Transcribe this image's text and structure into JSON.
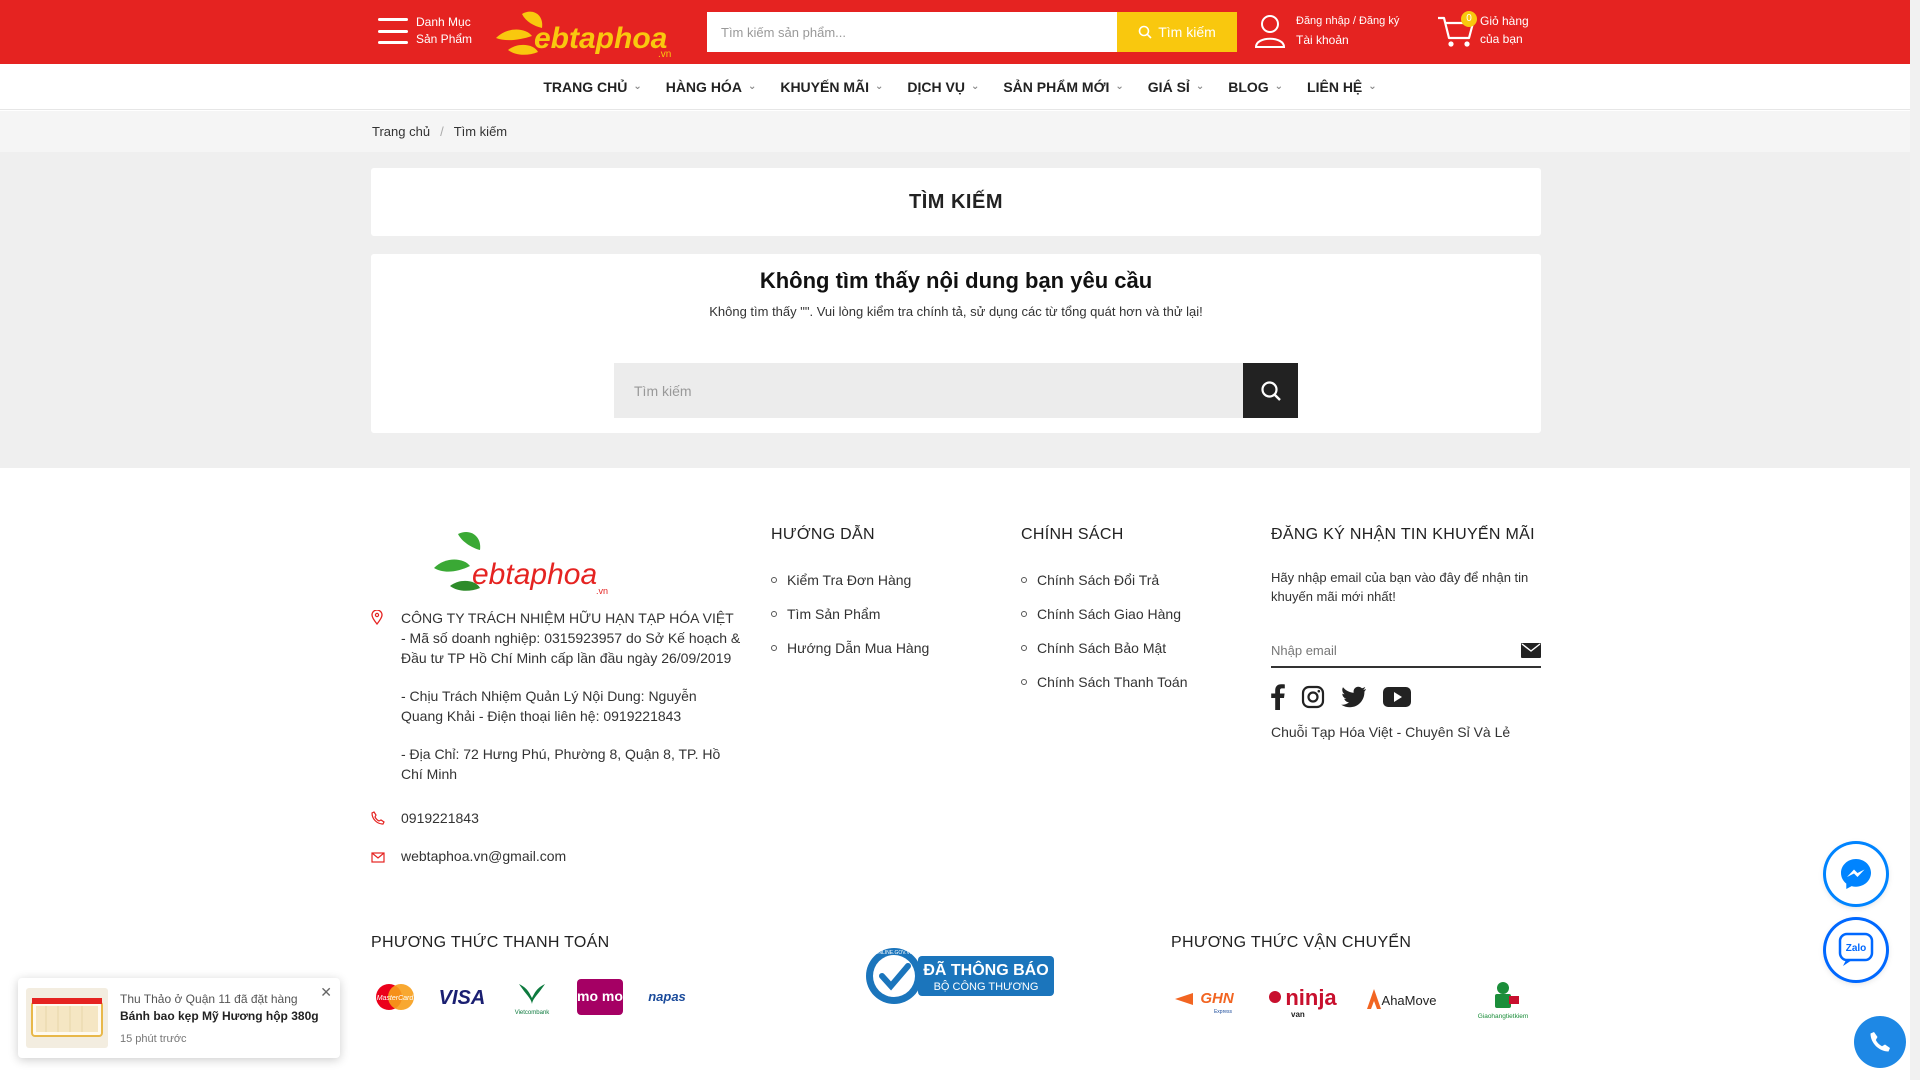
{
  "header": {
    "menu_line1": "Danh Mục",
    "menu_line2": "Sản Phẩm",
    "logo_text": "ebtaphoa",
    "logo_suffix": ".vn",
    "search_placeholder": "Tìm kiếm sản phẩm...",
    "search_button": "Tìm kiếm",
    "account_line1": "Đăng nhập / Đăng ký",
    "account_line2": "Tài khoản",
    "cart_count": "0",
    "cart_line1": "Giỏ hàng",
    "cart_line2": "của bạn"
  },
  "nav": {
    "items": [
      "TRANG CHỦ",
      "HÀNG HÓA",
      "KHUYẾN MÃI",
      "DỊCH VỤ",
      "SẢN PHẨM MỚI",
      "GIÁ SỈ",
      "BLOG",
      "LIÊN HỆ"
    ]
  },
  "breadcrumb": {
    "home": "Trang chủ",
    "separator": "/",
    "current": "Tìm kiếm"
  },
  "main": {
    "page_title": "TÌM KIẾM",
    "not_found_title": "Không tìm thấy nội dung bạn yêu cầu",
    "not_found_desc": "Không tìm thấy \"\". Vui lòng kiểm tra chính tả, sử dụng các từ tổng quát hơn và thử lại!",
    "search_placeholder": "Tìm kiếm"
  },
  "footer": {
    "company": "CÔNG TY TRÁCH NHIỆM HỮU HẠN TẠP HÓA VIỆT - Mã số doanh nghiệp: 0315923957 do Sở Kế hoạch & Đầu tư TP Hồ Chí Minh cấp lần đầu ngày 26/09/2019",
    "manager": "- Chịu Trách Nhiệm Quản Lý Nội Dung: Nguyễn Quang Khải - Điện thoại liên hệ: 0919221843",
    "address": "- Địa Chỉ: 72 Hưng Phú, Phường 8, Quận 8, TP. Hồ Chí Minh",
    "phone": "0919221843",
    "email": "webtaphoa.vn@gmail.com",
    "guide_title": "HƯỚNG DẪN",
    "guide_items": [
      "Kiểm Tra Đơn Hàng",
      "Tìm Sản Phẩm",
      "Hướng Dẫn Mua Hàng"
    ],
    "policy_title": "CHÍNH SÁCH",
    "policy_items": [
      "Chính Sách Đổi Trả",
      "Chính Sách Giao Hàng",
      "Chính Sách Bảo Mật",
      "Chính Sách Thanh Toán"
    ],
    "subscribe_title": "ĐĂNG KÝ NHẬN TIN KHUYẾN MÃI",
    "subscribe_desc": "Hãy nhập email của bạn vào đây để nhận tin khuyến mãi mới nhất!",
    "email_placeholder": "Nhập email",
    "tagline": "Chuỗi Tạp Hóa Việt - Chuyên Sỉ Và Lẻ",
    "payment_title": "PHƯƠNG THỨC THANH TOÁN",
    "payment_logos": [
      "MasterCard",
      "VISA",
      "Vietcombank",
      "mo mo",
      "napas"
    ],
    "gov_badge_line1": "ĐÃ THÔNG BÁO",
    "gov_badge_line2": "BỘ CÔNG THƯƠNG",
    "gov_badge_ring": "ONLINE.GOV.VN",
    "shipping_title": "PHƯƠNG THỨC VẬN CHUYỂN",
    "shipping_logos": [
      "GHN",
      "ninja",
      "AhaMove",
      "Giaohangtietkiem"
    ],
    "shipping_sub": {
      "ghn": "Express",
      "ninja": "van"
    }
  },
  "notification": {
    "line1": "Thu Thảo ở Quận 11 đã đặt hàng",
    "line2": "Bánh bao kẹp Mỹ Hương hộp 380g",
    "line3": "15 phút trước"
  },
  "floating": {
    "zalo_label": "Zalo"
  },
  "colors": {
    "brand_red": "#e52321",
    "accent_yellow": "#f9c80e",
    "dark": "#222222",
    "messenger_blue": "#0084ff"
  }
}
